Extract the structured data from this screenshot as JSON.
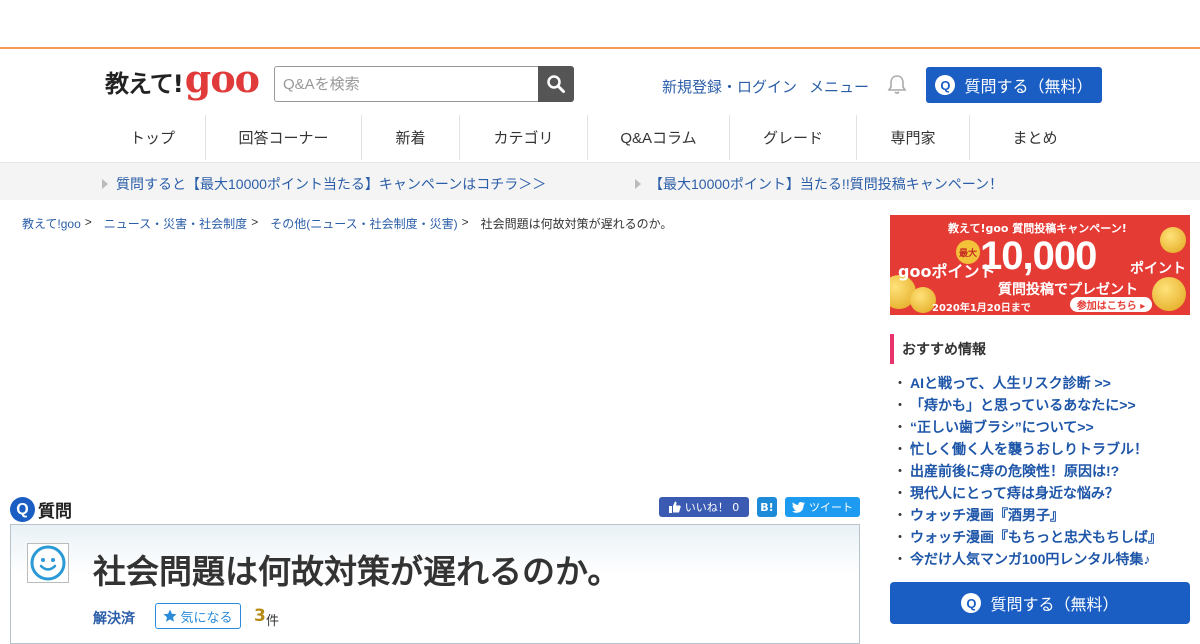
{
  "header": {
    "logo_text": "教えて!",
    "logo_goo": "goo",
    "search_placeholder": "Q&Aを検索",
    "login_label": "新規登録・ログイン",
    "menu_label": "メニュー",
    "ask_button_label": "質問する（無料）",
    "q_glyph": "Q"
  },
  "nav": {
    "items": [
      "トップ",
      "回答コーナー",
      "新着",
      "カテゴリ",
      "Q&Aコラム",
      "グレード",
      "専門家",
      "まとめ"
    ]
  },
  "campaigns": [
    "質問すると【最大10000ポイント当たる】キャンペーンはコチラ＞＞",
    "【最大10000ポイント】当たる!!質問投稿キャンペーン！"
  ],
  "breadcrumb": {
    "items": [
      "教えて!goo",
      "ニュース・災害・社会制度",
      "その他(ニュース・社会制度・災害)"
    ],
    "separator": ">",
    "current": "社会問題は何故対策が遅れるのか。"
  },
  "question": {
    "section_label": "質問",
    "title": "社会問題は何故対策が遅れるのか。",
    "status": "解決済",
    "favorite_label": "気になる",
    "count": "3",
    "count_unit": "件"
  },
  "social": {
    "like_label": "いいね！ 0",
    "hatena_label": "B!",
    "tweet_label": "ツイート"
  },
  "banner": {
    "top": "教えて!goo 質問投稿キャンペーン!",
    "max": "最大",
    "points_prefix": "gooポイント",
    "amount": "10,000",
    "points_suffix": "ポイント",
    "sub": "質問投稿でプレゼント",
    "date": "2020年1月20日まで",
    "cta": "参加はこちら ▸"
  },
  "recommend": {
    "title": "おすすめ情報",
    "bullet": "・",
    "items": [
      "AIと戦って、人生リスク診断 >>",
      "「痔かも」と思っているあなたに>>",
      "“正しい歯ブラシ”について>>",
      "忙しく働く人を襲うおしりトラブル！",
      "出産前後に痔の危険性！原因は!?",
      "現代人にとって痔は身近な悩み？",
      "ウォッチ漫画『酒男子』",
      "ウォッチ漫画『もちっと忠犬もちしば』",
      "今だけ人気マンガ100円レンタル特集♪"
    ]
  },
  "sidebar": {
    "ask_button_label": "質問する（無料）"
  },
  "colors": {
    "accent_blue": "#1a5ec4",
    "link_blue": "#2b5ea8",
    "brand_red": "#e03a3a",
    "orange_line": "#f59a5a",
    "recommend_bar": "#e8336d"
  }
}
